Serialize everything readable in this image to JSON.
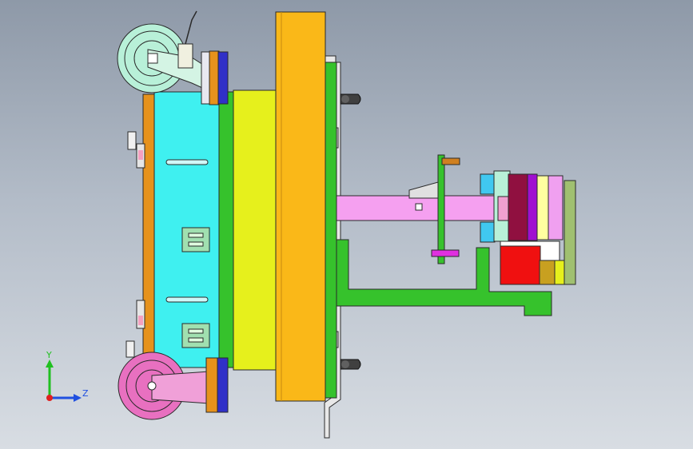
{
  "viewport": {
    "name": "cad-3d-viewport",
    "background_top": "#8e99a8",
    "background_bottom": "#d8dde3"
  },
  "triad": {
    "y_label": "Y",
    "z_label": "Z",
    "x_color": "#e02020",
    "y_color": "#20c020",
    "z_color": "#2050e0"
  },
  "colors": {
    "frame_cyan": "#3ff0f0",
    "plate_orange": "#e6921c",
    "plate_green": "#36c22c",
    "block_yellow": "#e6f01c",
    "base_gold": "#fab818",
    "arm_pink": "#f5a0f0",
    "caster_mint": "#b8f0d8",
    "caster_pink": "#e870c0",
    "blue_block": "#3030c8",
    "red_block": "#f01010"
  }
}
